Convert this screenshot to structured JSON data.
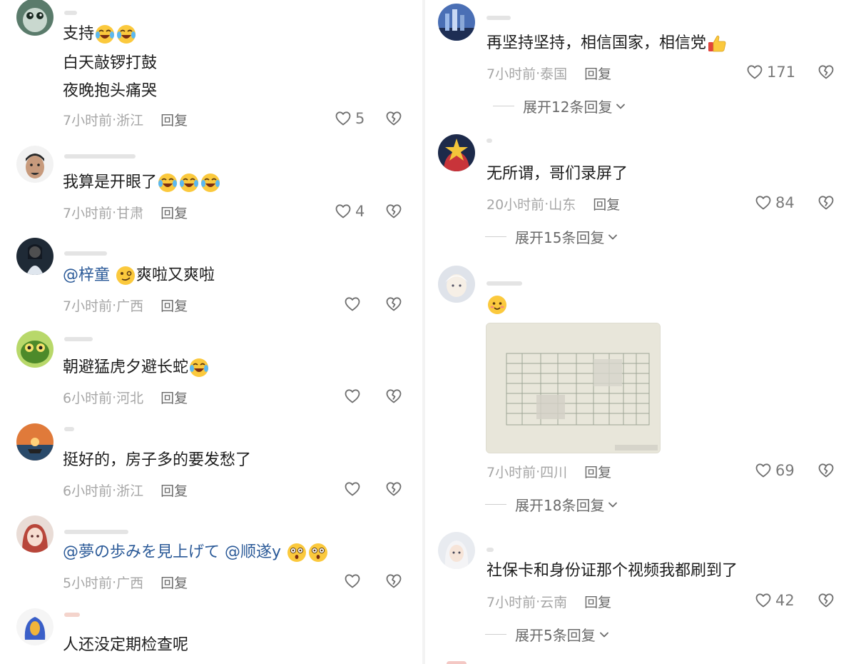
{
  "left_comments": [
    {
      "lines": [
        "支持",
        "白天敲锣打鼓",
        "夜晚抱头痛哭"
      ],
      "emoji": "laugh-cry",
      "emoji_count": 2,
      "time": "7小时前",
      "location": "浙江",
      "reply": "回复",
      "likes": "5"
    },
    {
      "text": "我算是开眼了",
      "emoji": "rofl",
      "emoji_count": 3,
      "time": "7小时前",
      "location": "甘肃",
      "reply": "回复",
      "likes": "4"
    },
    {
      "mention": "@梓童",
      "text": "爽啦又爽啦",
      "emoji": "smirk",
      "time": "7小时前",
      "location": "广西",
      "reply": "回复",
      "likes": ""
    },
    {
      "text": "朝避猛虎夕避长蛇",
      "emoji": "laugh-cry",
      "time": "6小时前",
      "location": "河北",
      "reply": "回复",
      "likes": ""
    },
    {
      "text": "挺好的，房子多的要发愁了",
      "time": "6小时前",
      "location": "浙江",
      "reply": "回复",
      "likes": ""
    },
    {
      "mention1": "@夢の歩みを見上げて",
      "mention2": "@顺遂y",
      "emoji": "shocked",
      "emoji_count": 2,
      "time": "5小时前",
      "location": "广西",
      "reply": "回复",
      "likes": ""
    },
    {
      "text": "人还没定期检查呢"
    }
  ],
  "right_comments": [
    {
      "text": "再坚持坚持，相信国家，相信党",
      "emoji": "thumbs-up",
      "time": "7小时前",
      "location": "泰国",
      "reply": "回复",
      "likes": "171",
      "expand": "展开12条回复"
    },
    {
      "text": "无所谓，哥们录屏了",
      "time": "20小时前",
      "location": "山东",
      "reply": "回复",
      "likes": "84",
      "expand": "展开15条回复"
    },
    {
      "emoji": "smile",
      "has_photo": true,
      "time": "7小时前",
      "location": "四川",
      "reply": "回复",
      "likes": "69",
      "expand": "展开18条回复"
    },
    {
      "text": "社保卡和身份证那个视频我都刷到了",
      "time": "7小时前",
      "location": "云南",
      "reply": "回复",
      "likes": "42",
      "expand": "展开5条回复"
    }
  ],
  "meta_separator": " · ",
  "icons": {
    "like": "heart-outline-icon",
    "dislike": "broken-heart-icon",
    "expand": "chevron-down-icon"
  },
  "colors": {
    "mention": "#2b5a98",
    "meta": "#a6a6a6",
    "text": "#1d1d1d"
  }
}
